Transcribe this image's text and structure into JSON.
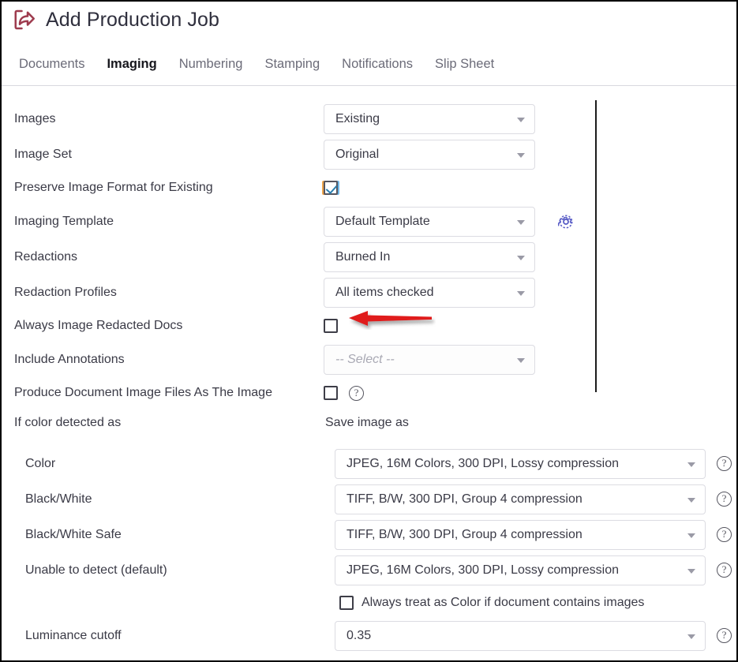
{
  "header": {
    "icon": "share-export-icon",
    "title": "Add Production Job",
    "icon_color": "#9e3b4e"
  },
  "tabs": [
    {
      "label": "Documents",
      "active": false
    },
    {
      "label": "Imaging",
      "active": true
    },
    {
      "label": "Numbering",
      "active": false
    },
    {
      "label": "Stamping",
      "active": false
    },
    {
      "label": "Notifications",
      "active": false
    },
    {
      "label": "Slip Sheet",
      "active": false
    }
  ],
  "imaging_settings": [
    {
      "label": "Images",
      "type": "select",
      "value": "Existing"
    },
    {
      "label": "Image Set",
      "type": "select",
      "value": "Original"
    },
    {
      "label": "Preserve Image Format for Existing",
      "type": "checkbox",
      "checked": true
    },
    {
      "label": "Imaging Template",
      "type": "select",
      "value": "Default Template",
      "gear": true
    },
    {
      "label": "Redactions",
      "type": "select",
      "value": "Burned In"
    },
    {
      "label": "Redaction Profiles",
      "type": "select",
      "value": "All items checked"
    },
    {
      "label": "Always Image Redacted Docs",
      "type": "checkbox",
      "checked": false,
      "annotated": true
    },
    {
      "label": "Include Annotations",
      "type": "select",
      "value": "-- Select --",
      "disabled": true
    },
    {
      "label": "Produce Document Image Files As The Image",
      "type": "checkbox",
      "checked": false,
      "help": true
    }
  ],
  "color_section": {
    "left_header": "If color detected as",
    "right_header": "Save image as",
    "rows": [
      {
        "label": "Color",
        "value": "JPEG, 16M Colors, 300 DPI, Lossy compression"
      },
      {
        "label": "Black/White",
        "value": "TIFF, B/W, 300 DPI, Group 4 compression"
      },
      {
        "label": "Black/White Safe",
        "value": "TIFF, B/W, 300 DPI, Group 4 compression"
      },
      {
        "label": "Unable to detect (default)",
        "value": "JPEG, 16M Colors, 300 DPI, Lossy compression"
      }
    ],
    "always_color_checkbox": {
      "label": "Always treat as Color if document contains images",
      "checked": false
    },
    "luminance": {
      "label": "Luminance cutoff",
      "value": "0.35"
    }
  },
  "annotation": {
    "type": "red-arrow",
    "color": "#e01b1b",
    "points_to": "Always Image Redacted Docs checkbox"
  },
  "icons": {
    "gear": "gear-icon",
    "help": "?",
    "caret": "chevron-down-icon"
  }
}
